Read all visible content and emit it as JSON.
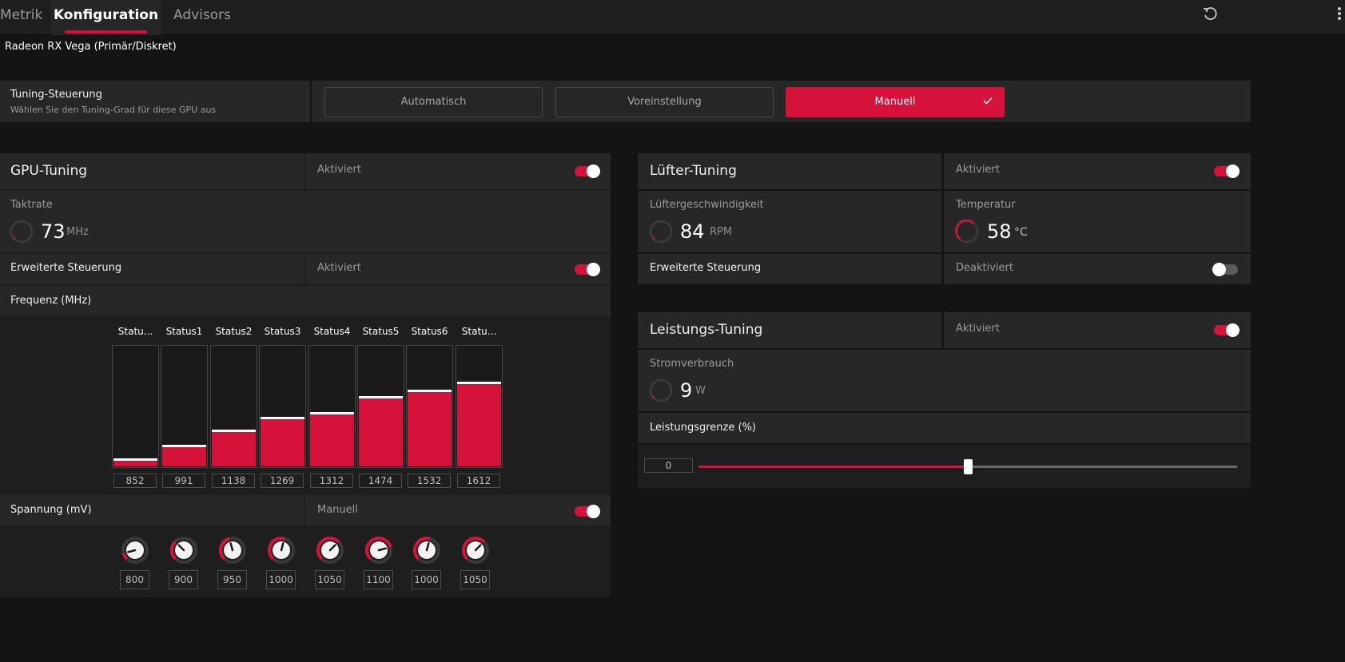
{
  "tabs": [
    {
      "label": "Metrik"
    },
    {
      "label": "Konfiguration"
    },
    {
      "label": "Advisors"
    }
  ],
  "gpu_name": "Radeon RX Vega (Primär/Diskret)",
  "tuning_control": {
    "title": "Tuning-Steuerung",
    "subtitle": "Wählen Sie den Tuning-Grad für diese GPU aus",
    "options": [
      "Automatisch",
      "Voreinstellung",
      "Manuell"
    ],
    "selected": "Manuell"
  },
  "gpu_tuning": {
    "title": "GPU-Tuning",
    "status": "Aktiviert",
    "enabled": true,
    "clock": {
      "label": "Taktrate",
      "value": "73",
      "unit": "MHz"
    },
    "advanced": {
      "label": "Erweiterte Steuerung",
      "status": "Aktiviert",
      "enabled": true
    },
    "frequency": {
      "label": "Frequenz (MHz)",
      "scale_min": 800,
      "scale_max": 2000,
      "states": [
        {
          "label": "Statu...",
          "value": "852"
        },
        {
          "label": "Status1",
          "value": "991"
        },
        {
          "label": "Status2",
          "value": "1138"
        },
        {
          "label": "Status3",
          "value": "1269"
        },
        {
          "label": "Status4",
          "value": "1312"
        },
        {
          "label": "Status5",
          "value": "1474"
        },
        {
          "label": "Status6",
          "value": "1532"
        },
        {
          "label": "Statu...",
          "value": "1612"
        }
      ]
    },
    "voltage": {
      "label": "Spannung (mV)",
      "status": "Manuell",
      "enabled": true,
      "scale_min": 750,
      "scale_max": 1200,
      "values": [
        "800",
        "900",
        "950",
        "1000",
        "1050",
        "1100",
        "1000",
        "1050"
      ]
    }
  },
  "fan_tuning": {
    "title": "Lüfter-Tuning",
    "status": "Aktiviert",
    "enabled": true,
    "speed": {
      "label": "Lüftergeschwindigkeit",
      "value": "84",
      "unit": "RPM"
    },
    "temperature": {
      "label": "Temperatur",
      "value": "58",
      "unit": "°C"
    },
    "advanced": {
      "label": "Erweiterte Steuerung",
      "status": "Deaktiviert",
      "enabled": false
    }
  },
  "power_tuning": {
    "title": "Leistungs-Tuning",
    "status": "Aktiviert",
    "enabled": true,
    "power": {
      "label": "Stromverbrauch",
      "value": "9",
      "unit": "W"
    },
    "limit": {
      "label": "Leistungsgrenze (%)",
      "value": "0",
      "fraction": 0.5
    }
  },
  "colors": {
    "accent": "#d7123a",
    "panel": "#272727",
    "background": "#141414"
  }
}
